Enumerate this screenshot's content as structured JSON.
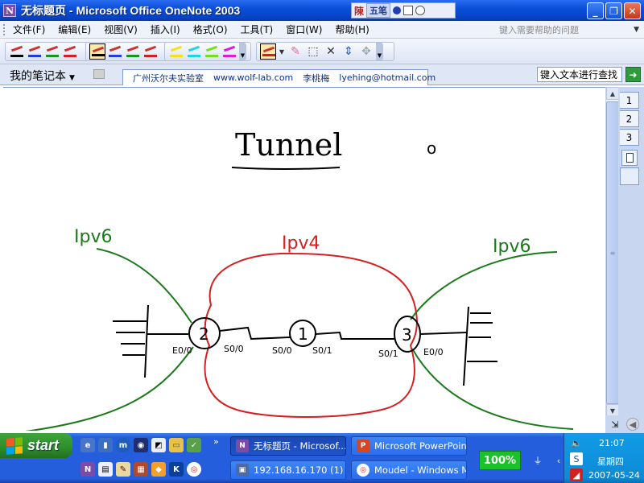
{
  "window": {
    "title": "无标题页 - Microsoft Office OneNote 2003",
    "app_icon": "onenote-icon"
  },
  "ime_bar": {
    "logo": "陳",
    "mode": "五笔"
  },
  "menu": {
    "items": [
      "文件(F)",
      "编辑(E)",
      "视图(V)",
      "插入(I)",
      "格式(O)",
      "工具(T)",
      "窗口(W)",
      "帮助(H)"
    ],
    "help_placeholder": "键入需要帮助的问题"
  },
  "toolbar": {
    "pen_colors": [
      "#000000",
      "#1f3fd8",
      "#16961c",
      "#d22020",
      "#000000",
      "#1f3fd8",
      "#16961c",
      "#d22020"
    ],
    "highlighter_colors": [
      "#f5e31a",
      "#19d8e6",
      "#73e01a",
      "#e01ad8"
    ]
  },
  "notebook": {
    "title": "我的笔记本",
    "page_tab_items": [
      "广州沃尔夫实验室",
      "www.wolf-lab.com",
      "李桃梅",
      "lyehing@hotmail.com"
    ],
    "search_placeholder": "键入文本进行查找"
  },
  "page_tabs": [
    "1",
    "2",
    "3"
  ],
  "note": {
    "heading": "Tunnel",
    "mark": "o",
    "left_label": "Ipv6",
    "center_label": "Ipv4",
    "right_label": "Ipv6",
    "routers": [
      "2",
      "1",
      "3"
    ],
    "interfaces": [
      "E0/0",
      "S0/0",
      "S0/0",
      "S0/1",
      "S0/1",
      "E0/0"
    ],
    "colors": {
      "ink": "#000000",
      "ipv6": "#1a7a1a",
      "ipv4": "#d42020"
    }
  },
  "taskbar": {
    "start_label": "start",
    "tasks_row1": [
      "无标题页 - Microsof...",
      "Microsoft PowerPoin..."
    ],
    "tasks_row2": [
      "192.168.16.170 (1) ...",
      "Moudel - Windows M..."
    ],
    "zoom": "100%",
    "time": "21:07",
    "weekday": "星期四",
    "date": "2007-05-24"
  }
}
